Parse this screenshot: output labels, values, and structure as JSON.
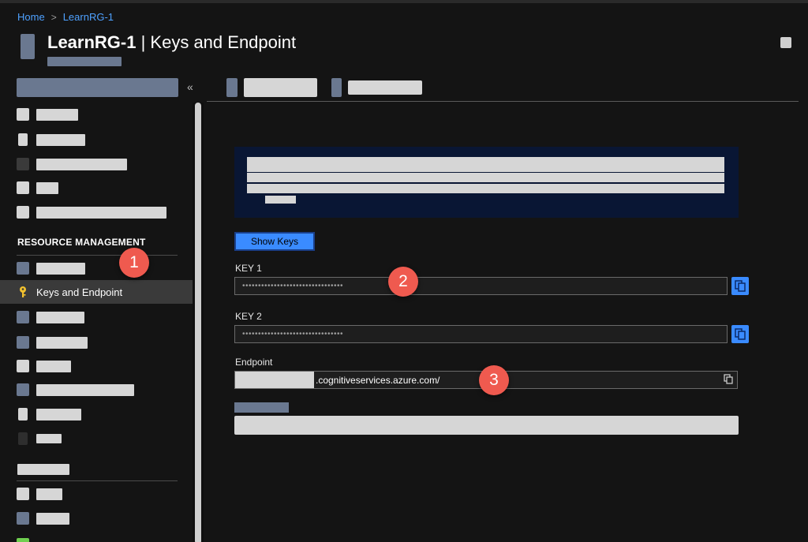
{
  "breadcrumb": {
    "home": "Home",
    "separator": ">",
    "current": "LearnRG-1"
  },
  "page": {
    "title_bold": "LearnRG-1",
    "title_rest": " | Keys and Endpoint"
  },
  "sidebar": {
    "collapse_glyph": "«",
    "section_title": "RESOURCE MANAGEMENT",
    "active_item": {
      "label": "Keys and Endpoint",
      "icon": "key-icon"
    }
  },
  "actions": {
    "show_keys": "Show Keys"
  },
  "fields": {
    "key1": {
      "label": "KEY 1",
      "value": "••••••••••••••••••••••••••••••••"
    },
    "key2": {
      "label": "KEY 2",
      "value": "••••••••••••••••••••••••••••••••"
    },
    "endpoint": {
      "label": "Endpoint",
      "value": ".cognitiveservices.azure.com/"
    }
  },
  "callouts": [
    "1",
    "2",
    "3"
  ],
  "colors": {
    "accent": "#3a8bff",
    "link": "#4ea1ff",
    "callout": "#ef5a4f",
    "key_icon": "#f2c12e"
  }
}
